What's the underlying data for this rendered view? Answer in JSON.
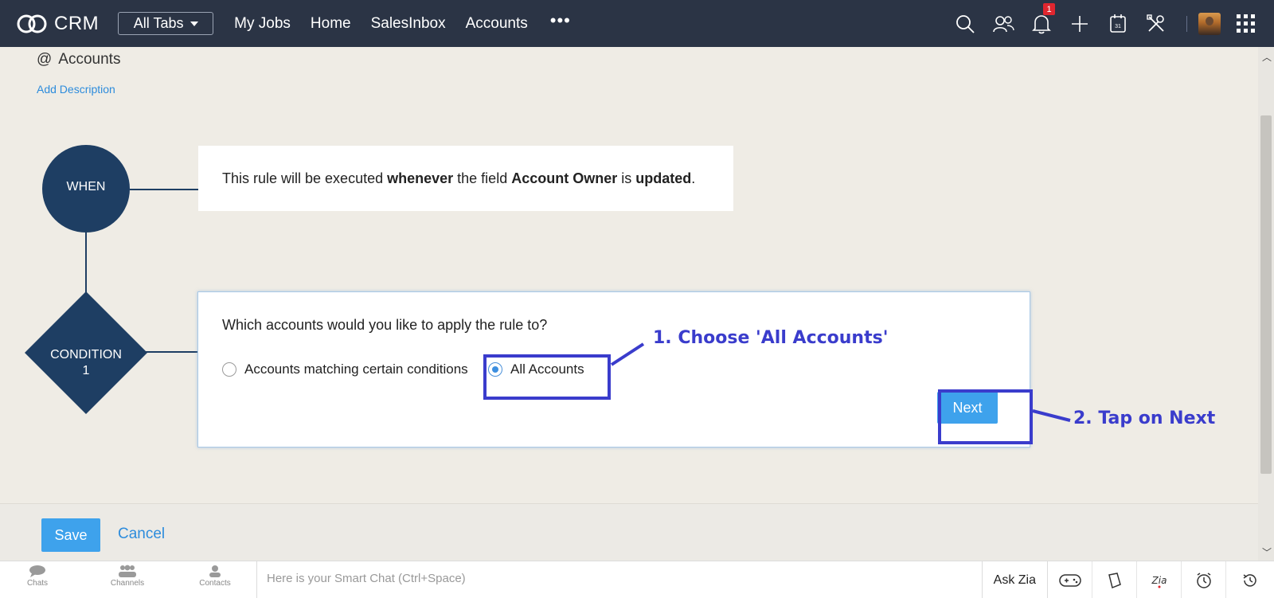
{
  "nav": {
    "app_name": "CRM",
    "all_tabs_label": "All Tabs",
    "links": [
      "My Jobs",
      "Home",
      "SalesInbox",
      "Accounts"
    ],
    "more_label": "•••",
    "notification_count": "1"
  },
  "page": {
    "title_prefix": "@",
    "title": "Accounts",
    "add_description": "Add Description"
  },
  "flow": {
    "when_label": "WHEN",
    "condition_label_line1": "CONDITION",
    "condition_label_line2": "1"
  },
  "when_rule": {
    "t1": "This rule will be executed ",
    "b1": "whenever",
    "t2": " the field ",
    "b2": "Account Owner",
    "t3": " is ",
    "b3": "updated",
    "t4": "."
  },
  "condition": {
    "question": "Which accounts would you like to apply the rule to?",
    "options": [
      {
        "label": "Accounts matching certain conditions",
        "selected": false
      },
      {
        "label": "All Accounts",
        "selected": true
      }
    ],
    "next_label": "Next"
  },
  "annotations": {
    "step1": "1. Choose 'All Accounts'",
    "step2": "2. Tap on Next"
  },
  "footer": {
    "save_label": "Save",
    "cancel_label": "Cancel"
  },
  "chatbar": {
    "items": [
      "Chats",
      "Channels",
      "Contacts"
    ],
    "placeholder": "Here is your Smart Chat (Ctrl+Space)",
    "ask_zia": "Ask Zia"
  },
  "colors": {
    "nav_bg": "#2b3445",
    "flow_node": "#1e3e63",
    "accent": "#3ea2ec",
    "annotation": "#3a3ccc"
  }
}
